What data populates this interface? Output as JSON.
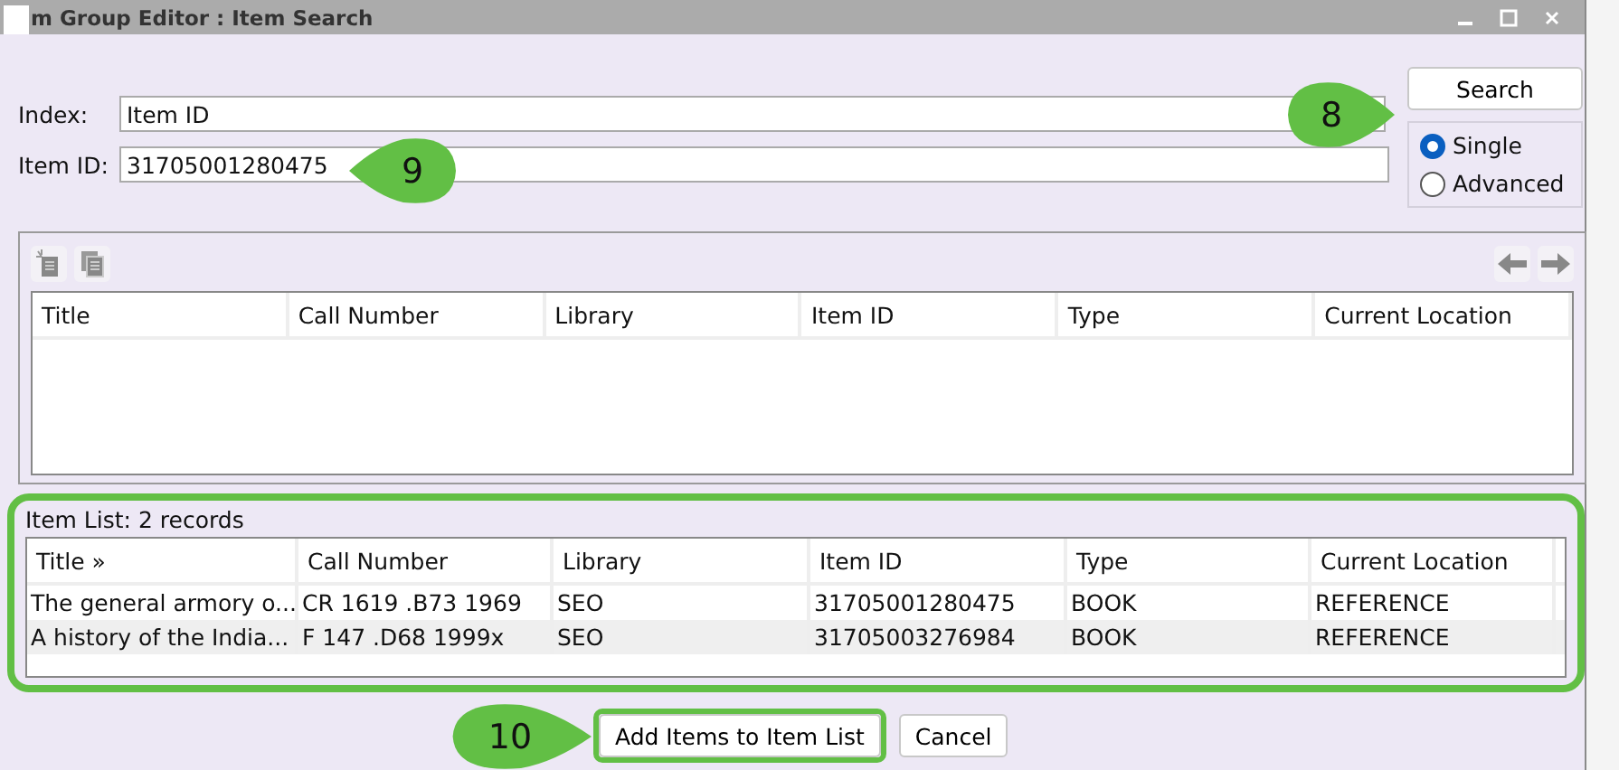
{
  "window": {
    "title": "m Group Editor : Item Search"
  },
  "search_form": {
    "index_label": "Index:",
    "index_value": "Item ID",
    "item_id_label": "Item ID:",
    "item_id_value": "31705001280475",
    "item_id_callout": "9"
  },
  "search_button": "Search",
  "mode": {
    "callout": "8",
    "options": [
      {
        "label": "Single",
        "selected": true
      },
      {
        "label": "Advanced",
        "selected": false
      }
    ]
  },
  "results_table": {
    "columns": [
      "Title",
      "Call Number",
      "Library",
      "Item ID",
      "Type",
      "Current Location"
    ]
  },
  "item_list": {
    "title": "Item List: 2 records",
    "highlighted": true,
    "columns": [
      "Title »",
      "Call Number",
      "Library",
      "Item ID",
      "Type",
      "Current Location"
    ],
    "rows": [
      [
        "The general armory o...",
        "CR 1619 .B73 1969",
        "SEO",
        "31705001280475",
        "BOOK",
        "REFERENCE"
      ],
      [
        "A history of the India...",
        "F 147 .D68 1999x",
        "SEO",
        "31705003276984",
        "BOOK",
        "REFERENCE"
      ]
    ]
  },
  "buttons": [
    {
      "label": "Add Items to Item List",
      "highlighted": true,
      "callout": "10"
    },
    {
      "label": "Cancel",
      "highlighted": false
    }
  ]
}
